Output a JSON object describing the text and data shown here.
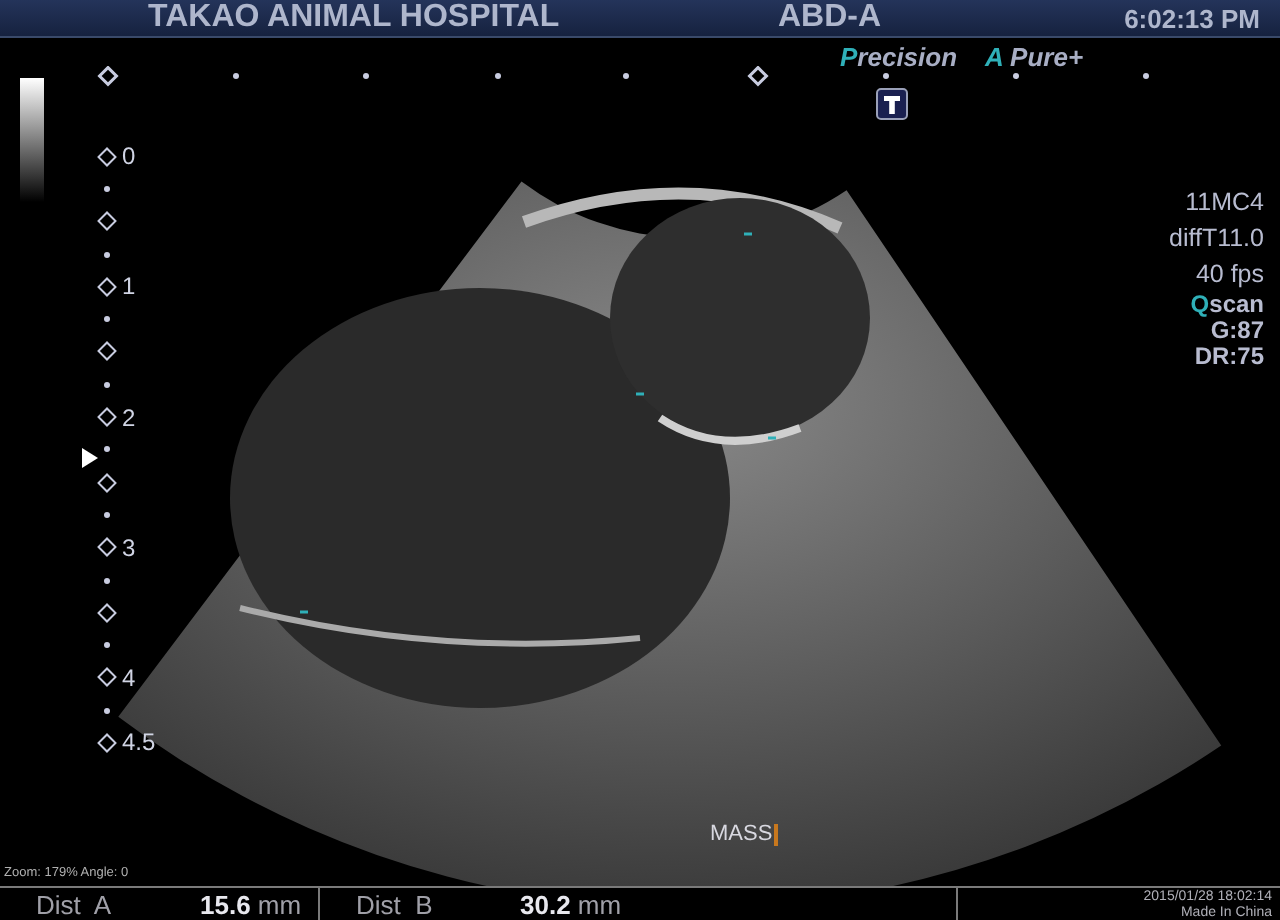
{
  "header": {
    "title": "TAKAO ANIMAL HOSPITAL",
    "preset": "ABD-A",
    "time": "6:02:13 PM"
  },
  "modes": [
    {
      "accent": "P",
      "rest": "recision"
    },
    {
      "accent": "A",
      "rest": " Pure+"
    }
  ],
  "depth_scale": [
    "0",
    "1",
    "2",
    "3",
    "4",
    "4.5"
  ],
  "info": [
    {
      "rest": "11MC4"
    },
    {
      "rest": "diffT11.0"
    },
    {
      "rest": "40 fps"
    },
    {
      "accent": "Q",
      "rest": "scan"
    },
    {
      "rest": "G:87"
    },
    {
      "rest": "DR:75"
    }
  ],
  "annotation": "MASS",
  "zoom_info": "Zoom: 179% Angle: 0",
  "measurements": [
    {
      "label": "Dist  A",
      "value": "**15.6** mm"
    },
    {
      "label": "Dist  B",
      "value": "**30.2** mm"
    }
  ],
  "footer": {
    "date": "2015/01/28 18:02:14",
    "note": "Made In China"
  }
}
